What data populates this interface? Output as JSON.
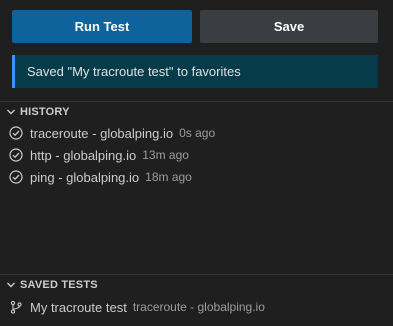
{
  "buttons": {
    "run_label": "Run Test",
    "save_label": "Save"
  },
  "notification": {
    "message": "Saved \"My tracroute test\" to favorites"
  },
  "history": {
    "title": "HISTORY",
    "items": [
      {
        "label": "traceroute - globalping.io",
        "time": "0s ago",
        "icon": "check-circle-icon"
      },
      {
        "label": "http - globalping.io",
        "time": "13m ago",
        "icon": "check-circle-icon"
      },
      {
        "label": "ping - globalping.io",
        "time": "18m ago",
        "icon": "check-circle-icon"
      }
    ]
  },
  "saved_tests": {
    "title": "SAVED TESTS",
    "items": [
      {
        "label": "My tracroute test",
        "desc": "traceroute - globalping.io",
        "icon": "git-branch-icon"
      }
    ]
  },
  "colors": {
    "primary": "#0e639c",
    "secondary": "#3a3d41",
    "notice_bg": "#063b49",
    "notice_border": "#3794ff"
  }
}
